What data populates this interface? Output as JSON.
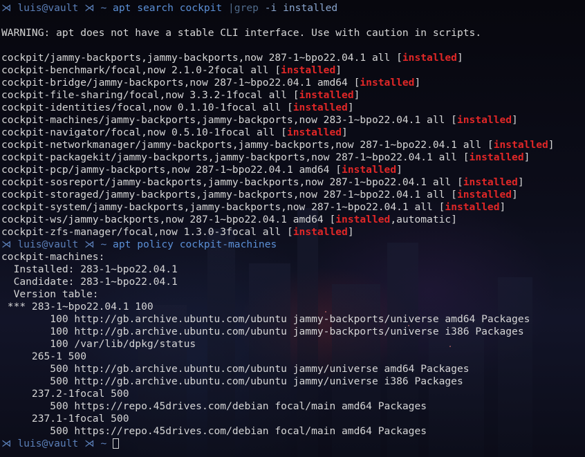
{
  "prompt": {
    "user": "luis@vault",
    "arrow": "⋊",
    "dir": "~"
  },
  "commands": {
    "cmd1": {
      "prog": "apt",
      "args": "search cockpit",
      "pipe": "|grep",
      "rest": "-i installed"
    },
    "cmd2": {
      "prog": "apt",
      "args": "policy cockpit-machines"
    }
  },
  "warning": "WARNING: apt does not have a stable CLI interface. Use with caution in scripts.",
  "results": [
    {
      "pre": "cockpit/jammy-backports,jammy-backports,now 287-1~bpo22.04.1 all [",
      "tag": "installed",
      "post": "]"
    },
    {
      "pre": "cockpit-benchmark/focal,now 2.1.0-2focal all [",
      "tag": "installed",
      "post": "]"
    },
    {
      "pre": "cockpit-bridge/jammy-backports,now 287-1~bpo22.04.1 amd64 [",
      "tag": "installed",
      "post": "]"
    },
    {
      "pre": "cockpit-file-sharing/focal,now 3.3.2-1focal all [",
      "tag": "installed",
      "post": "]"
    },
    {
      "pre": "cockpit-identities/focal,now 0.1.10-1focal all [",
      "tag": "installed",
      "post": "]"
    },
    {
      "pre": "cockpit-machines/jammy-backports,jammy-backports,now 283-1~bpo22.04.1 all [",
      "tag": "installed",
      "post": "]"
    },
    {
      "pre": "cockpit-navigator/focal,now 0.5.10-1focal all [",
      "tag": "installed",
      "post": "]"
    },
    {
      "pre": "cockpit-networkmanager/jammy-backports,jammy-backports,now 287-1~bpo22.04.1 all [",
      "tag": "installed",
      "post": "]"
    },
    {
      "pre": "cockpit-packagekit/jammy-backports,jammy-backports,now 287-1~bpo22.04.1 all [",
      "tag": "installed",
      "post": "]"
    },
    {
      "pre": "cockpit-pcp/jammy-backports,now 287-1~bpo22.04.1 amd64 [",
      "tag": "installed",
      "post": "]"
    },
    {
      "pre": "cockpit-sosreport/jammy-backports,jammy-backports,now 287-1~bpo22.04.1 all [",
      "tag": "installed",
      "post": "]"
    },
    {
      "pre": "cockpit-storaged/jammy-backports,jammy-backports,now 287-1~bpo22.04.1 all [",
      "tag": "installed",
      "post": "]"
    },
    {
      "pre": "cockpit-system/jammy-backports,jammy-backports,now 287-1~bpo22.04.1 all [",
      "tag": "installed",
      "post": "]"
    },
    {
      "pre": "cockpit-ws/jammy-backports,now 287-1~bpo22.04.1 amd64 [",
      "tag": "installed",
      "post": ",automatic]"
    },
    {
      "pre": "cockpit-zfs-manager/focal,now 1.3.0-3focal all [",
      "tag": "installed",
      "post": "]"
    }
  ],
  "policy": [
    "cockpit-machines:",
    "  Installed: 283-1~bpo22.04.1",
    "  Candidate: 283-1~bpo22.04.1",
    "  Version table:",
    " *** 283-1~bpo22.04.1 100",
    "        100 http://gb.archive.ubuntu.com/ubuntu jammy-backports/universe amd64 Packages",
    "        100 http://gb.archive.ubuntu.com/ubuntu jammy-backports/universe i386 Packages",
    "        100 /var/lib/dpkg/status",
    "     265-1 500",
    "        500 http://gb.archive.ubuntu.com/ubuntu jammy/universe amd64 Packages",
    "        500 http://gb.archive.ubuntu.com/ubuntu jammy/universe i386 Packages",
    "     237.2-1focal 500",
    "        500 https://repo.45drives.com/debian focal/main amd64 Packages",
    "     237.1-1focal 500",
    "        500 https://repo.45drives.com/debian focal/main amd64 Packages"
  ],
  "colors": {
    "installed": "#e02727",
    "prompt": "#5b7fb8",
    "command": "#5b8fd6",
    "text": "#d6d6d6"
  }
}
